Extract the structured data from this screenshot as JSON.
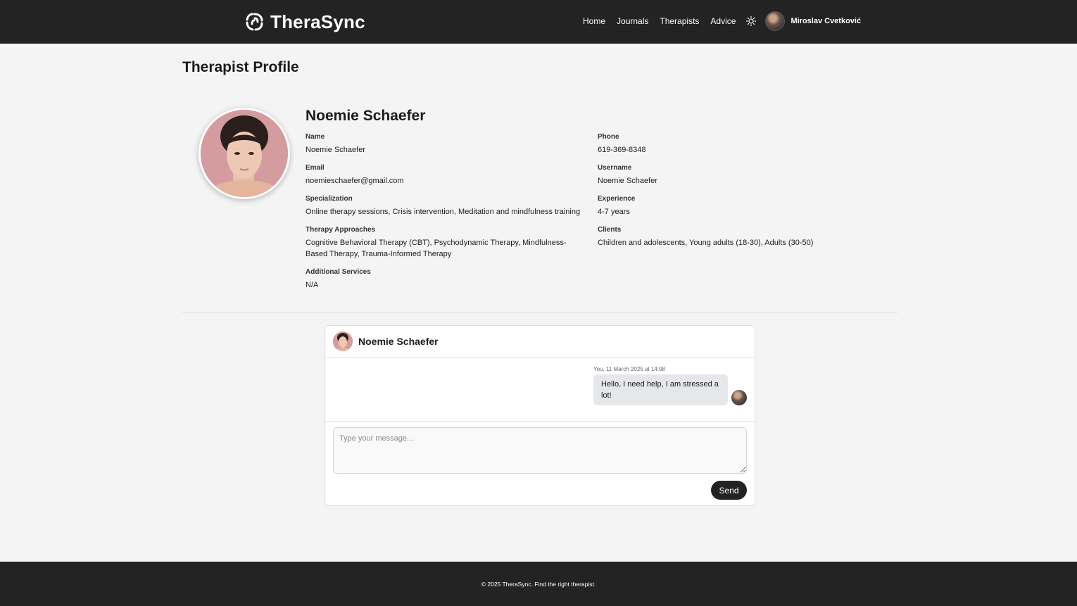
{
  "header": {
    "brand": "TheraSync",
    "nav": [
      "Home",
      "Journals",
      "Therapists",
      "Advice"
    ],
    "user_name": "Miroslav Cvetković"
  },
  "page": {
    "title": "Therapist Profile"
  },
  "profile": {
    "name_heading": "Noemie Schaefer",
    "fields": {
      "name": {
        "label": "Name",
        "value": "Noemie Schaefer"
      },
      "phone": {
        "label": "Phone",
        "value": "619-369-8348"
      },
      "email": {
        "label": "Email",
        "value": "noemieschaefer@gmail.com"
      },
      "username": {
        "label": "Username",
        "value": "Noemie Schaefer"
      },
      "specialization": {
        "label": "Specialization",
        "value": "Online therapy sessions, Crisis intervention, Meditation and mindfulness training"
      },
      "experience": {
        "label": "Experience",
        "value": "4-7 years"
      },
      "approaches": {
        "label": "Therapy Approaches",
        "value": "Cognitive Behavioral Therapy (CBT), Psychodynamic Therapy, Mindfulness-Based Therapy, Trauma-Informed Therapy"
      },
      "clients": {
        "label": "Clients",
        "value": "Children and adolescents, Young adults (18-30), Adults (30-50)"
      },
      "additional": {
        "label": "Additional Services",
        "value": "N/A"
      }
    }
  },
  "chat": {
    "title": "Noemie Schaefer",
    "messages": [
      {
        "meta": "You, 11 March 2025 at 14:08",
        "text": "Hello, I need help, I am stressed a lot!"
      }
    ],
    "input_placeholder": "Type your message...",
    "send_label": "Send"
  },
  "footer": {
    "text": "© 2025 TheraSync. Find the right therapist."
  }
}
